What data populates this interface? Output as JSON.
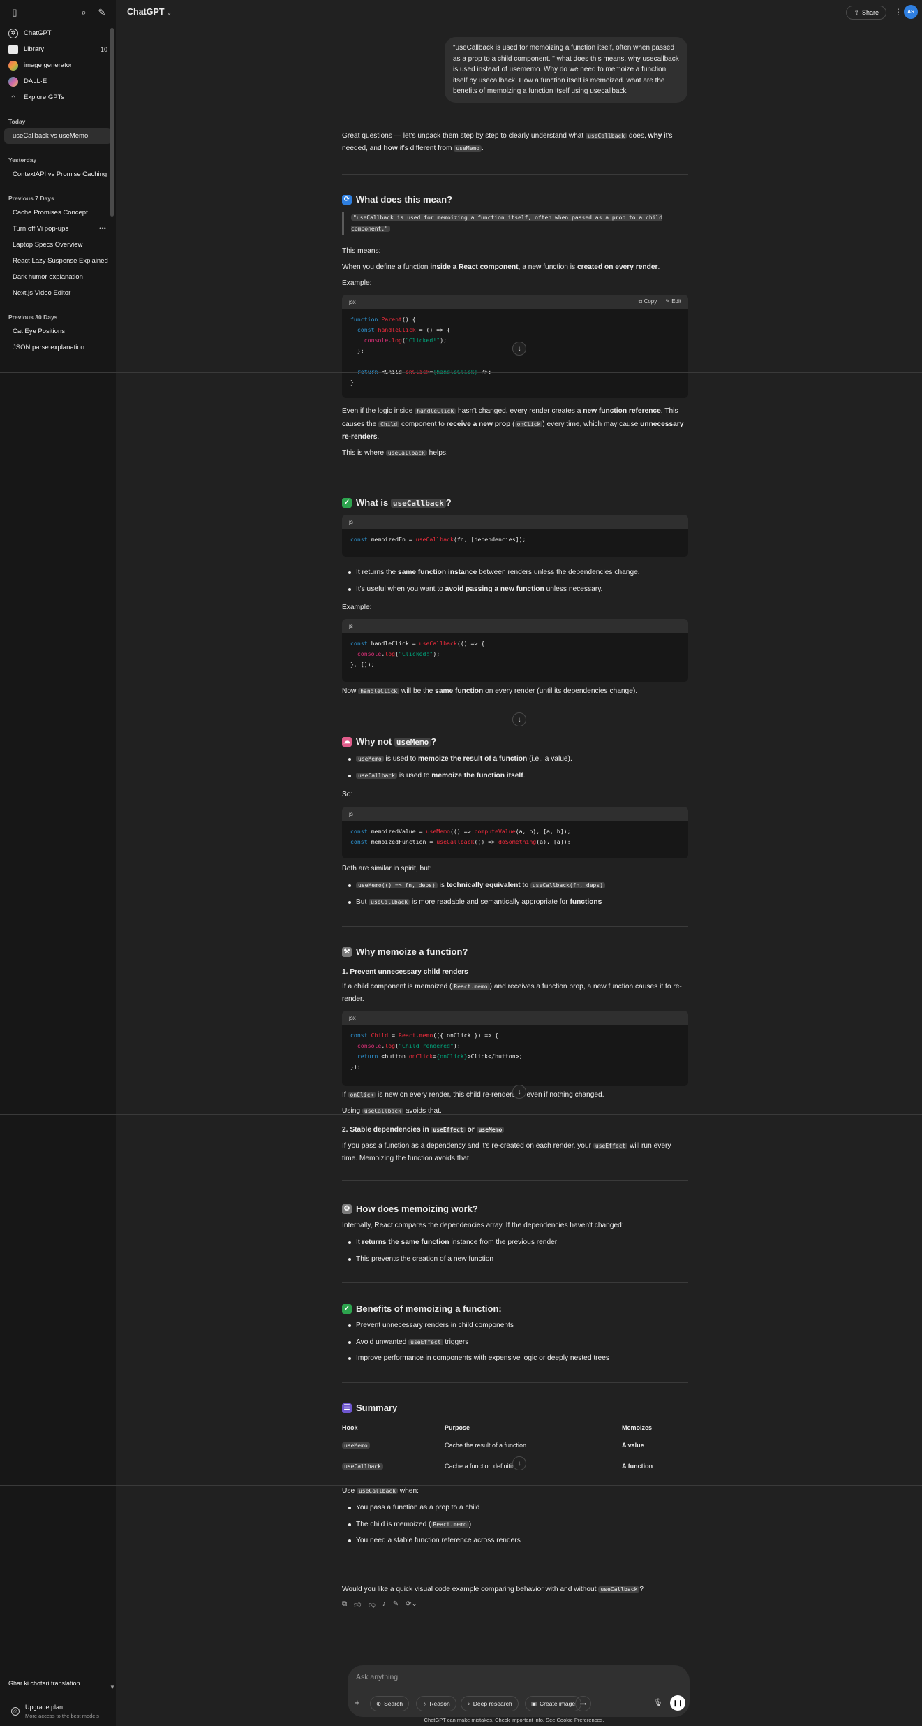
{
  "sidebar": {
    "nav": [
      {
        "label": "ChatGPT",
        "icon": "chatgpt-logo-icon"
      },
      {
        "label": "Library",
        "icon": "library-icon",
        "count": "10"
      },
      {
        "label": "image generator",
        "icon": "gpt-avatar-icon"
      },
      {
        "label": "DALL·E",
        "icon": "gpt-avatar-icon"
      },
      {
        "label": "Explore GPTs",
        "icon": "grid-icon"
      }
    ],
    "sections": [
      {
        "title": "Today",
        "chats": [
          "useCallback vs useMemo"
        ]
      },
      {
        "title": "Yesterday",
        "chats": [
          "ContextAPI vs Promise Caching"
        ]
      },
      {
        "title": "Previous 7 Days",
        "chats": [
          "Cache Promises Concept",
          "Turn off Vi pop-ups",
          "Laptop Specs Overview",
          "React Lazy Suspense Explained",
          "Dark humor explanation",
          "Next.js Video Editor"
        ]
      },
      {
        "title": "Previous 30 Days",
        "chats": [
          "Cat Eye Positions",
          "JSON parse explanation"
        ]
      }
    ],
    "bottom_chat": "Ghar ki chotari translation",
    "upgrade_title": "Upgrade plan",
    "upgrade_sub": "More access to the best models"
  },
  "header": {
    "model": "ChatGPT",
    "share": "Share",
    "avatar": "AS"
  },
  "user_message": "\"useCallback is used for memoizing a function itself, often when passed as a prop to a child component. \" what does this means. why usecallback is used instead of usememo. Why do we need to memoize a function itself by usecallback. How a function itself is memoized. what are the benefits of memoizing a function itself using usecallback",
  "answer": {
    "intro_pre": "Great questions — let's unpack them step by step to clearly understand what ",
    "intro_code": "useCallback",
    "intro_mid": " does, ",
    "intro_why": "why",
    "intro_mid2": " it's needed, and ",
    "intro_how": "how",
    "intro_mid3": " it's different from ",
    "intro_code2": "useMemo",
    "intro_end": ".",
    "s1_title": "What does this mean?",
    "s1_quote": "\"useCallback is used for memoizing a function itself, often when passed as a prop to a child component.\"",
    "s1_means": "This means:",
    "s1_when_pre": "When you define a function ",
    "s1_when_b1": "inside a React component",
    "s1_when_mid": ", a new function is ",
    "s1_when_b2": "created on every render",
    "s1_when_end": ".",
    "example": "Example:",
    "code_lang_jsx": "jsx",
    "code_lang_js": "js",
    "copy": "Copy",
    "edit": "Edit",
    "s1_even": "Even if the logic inside handleClick hasn't changed, every render creates a new function reference. This causes the Child component to receive a new prop (onClick) every time, which may cause unnecessary re-renders.",
    "s1_this_is": "This is where useCallback helps.",
    "s2_title": "What is useCallback?",
    "s2_b1": "It returns the same function instance between renders unless the dependencies change.",
    "s2_b2": "It's useful when you want to avoid passing a new function unless necessary.",
    "s2_now": "Now handleClick will be the same function on every render (until its dependencies change).",
    "s3_title": "Why not useMemo?",
    "s3_b1": "useMemo is used to memoize the result of a function (i.e., a value).",
    "s3_b2": "useCallback is used to memoize the function itself.",
    "s3_so": "So:",
    "s3_both": "Both are similar in spirit, but:",
    "s3_b3": "useMemo(() => fn, deps) is technically equivalent to useCallback(fn, deps)",
    "s3_b4": "But useCallback is more readable and semantically appropriate for functions",
    "s4_title": "Why memoize a function?",
    "s4_sub1": "1. Prevent unnecessary child renders",
    "s4_p1": "If a child component is memoized (React.memo) and receives a function prop, a new function causes it to re-render.",
    "s4_p2": "If onClick is new on every render, this child re-renders — even if nothing changed.",
    "s4_p3": "Using useCallback avoids that.",
    "s4_sub2": "2. Stable dependencies in useEffect or useMemo",
    "s4_p4": "If you pass a function as a dependency and it's re-created on each render, your useEffect will run every time. Memoizing the function avoids that.",
    "s5_title": "How does memoizing work?",
    "s5_p": "Internally, React compares the dependencies array. If the dependencies haven't changed:",
    "s5_b1": "It returns the same function instance from the previous render",
    "s5_b2": "This prevents the creation of a new function",
    "s6_title": "Benefits of memoizing a function:",
    "s6_b1": "Prevent unnecessary renders in child components",
    "s6_b2": "Avoid unwanted useEffect triggers",
    "s6_b3": "Improve performance in components with expensive logic or deeply nested trees",
    "s7_title": "Summary",
    "table_headers": [
      "Hook",
      "Purpose",
      "Memoizes"
    ],
    "table_rows": [
      [
        "useMemo",
        "Cache the result of a function",
        "A value"
      ],
      [
        "useCallback",
        "Cache a function definition",
        "A function"
      ]
    ],
    "use_when_pre": "Use ",
    "use_when_code": "useCallback",
    "use_when_end": " when:",
    "s7_b1": "You pass a function as a prop to a child",
    "s7_b2": "The child is memoized (React.memo)",
    "s7_b3": "You need a stable function reference across renders",
    "closing": "Would you like a quick visual code example comparing behavior with and without useCallback?"
  },
  "composer": {
    "placeholder": "Ask anything",
    "tools": [
      "Search",
      "Reason",
      "Deep research",
      "Create image"
    ],
    "footer": "ChatGPT can make mistakes. Check important info. See Cookie Preferences."
  }
}
